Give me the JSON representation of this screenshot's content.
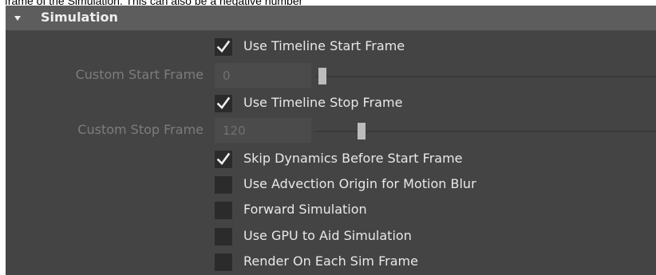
{
  "caption": "frame of the Simulation. This can also be a negative number",
  "section": {
    "title": "Simulation"
  },
  "use_timeline_start": {
    "label": "Use Timeline Start Frame",
    "checked": true
  },
  "custom_start": {
    "label": "Custom Start Frame",
    "value": "0"
  },
  "use_timeline_stop": {
    "label": "Use Timeline Stop Frame",
    "checked": true
  },
  "custom_stop": {
    "label": "Custom Stop Frame",
    "value": "120"
  },
  "skip_dynamics": {
    "label": "Skip Dynamics Before Start Frame",
    "checked": true
  },
  "advection_origin": {
    "label": "Use Advection Origin for Motion Blur",
    "checked": false
  },
  "forward_sim": {
    "label": "Forward Simulation",
    "checked": false
  },
  "gpu_aid": {
    "label": "Use GPU to Aid Simulation",
    "checked": false
  },
  "render_each": {
    "label": "Render On Each Sim Frame",
    "checked": false
  },
  "colors": {
    "panel_bg": "#444444",
    "header_bg": "#5d5d5d",
    "checkbox_bg": "#2b2b2b",
    "text": "#e8e8e8",
    "disabled_text": "#7c7c7c"
  }
}
